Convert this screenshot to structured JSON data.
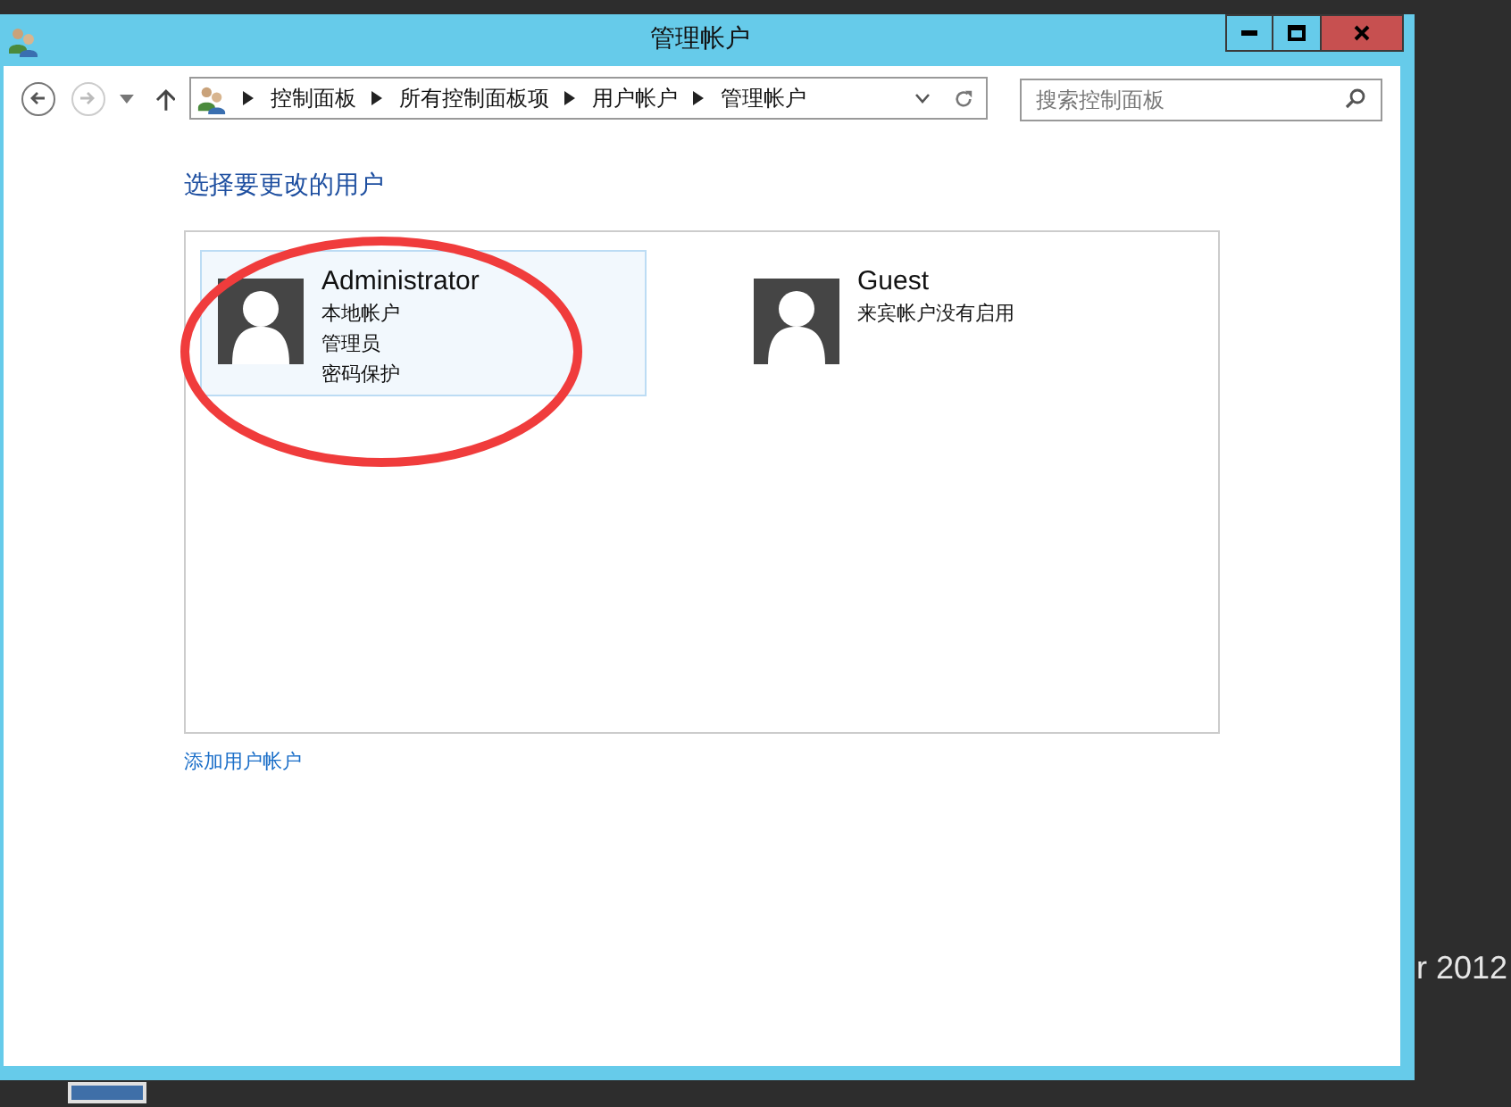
{
  "window": {
    "title": "管理帐户"
  },
  "address_bar": {
    "breadcrumbs": [
      "控制面板",
      "所有控制面板项",
      "用户帐户",
      "管理帐户"
    ]
  },
  "search": {
    "placeholder": "搜索控制面板"
  },
  "heading": "选择要更改的用户",
  "accounts": [
    {
      "name": "Administrator",
      "details": [
        "本地帐户",
        "管理员",
        "密码保护"
      ],
      "selected": true
    },
    {
      "name": "Guest",
      "details": [
        "来宾帐户没有启用"
      ],
      "selected": false
    }
  ],
  "add_account_link": "添加用户帐户",
  "desktop": {
    "text": "r 2012"
  }
}
